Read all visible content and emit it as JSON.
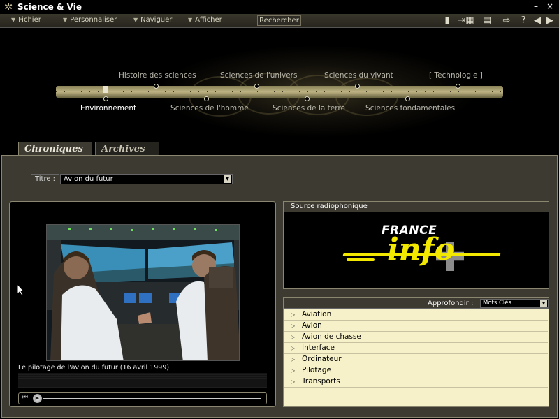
{
  "window": {
    "title": "Science & Vie"
  },
  "menu": {
    "items": [
      "Fichier",
      "Personnaliser",
      "Naviguer",
      "Afficher"
    ],
    "search_label": "Rechercher"
  },
  "nav": {
    "top_links": [
      "Histoire des sciences",
      "Sciences de l'univers",
      "Sciences du vivant",
      "[  Technologie  ]"
    ],
    "bottom_links": [
      "Environnement",
      "Sciences de l'homme",
      "Sciences de la terre",
      "Sciences fondamentales"
    ],
    "active": "Environnement"
  },
  "tabs": {
    "chroniques": "Chroniques",
    "archives": "Archives"
  },
  "titre": {
    "label": "Titre :",
    "value": "Avion du futur"
  },
  "video": {
    "caption": "Le pilotage de l'avion du futur (16 avril 1999)"
  },
  "source": {
    "header": "Source radiophonique",
    "logo_top": "FRANCE",
    "logo_bottom": "info"
  },
  "approfondir": {
    "label": "Approfondir :",
    "select_value": "Mots Clés",
    "keywords": [
      "Aviation",
      "Avion",
      "Avion de chasse",
      "Interface",
      "Ordinateur",
      "Pilotage",
      "Transports"
    ]
  },
  "icons": [
    "app-gear-icon",
    "bookmark-icon",
    "forward-page-icon",
    "print-icon",
    "export-icon",
    "help-icon",
    "back-arrow-icon",
    "forward-arrow-icon"
  ]
}
